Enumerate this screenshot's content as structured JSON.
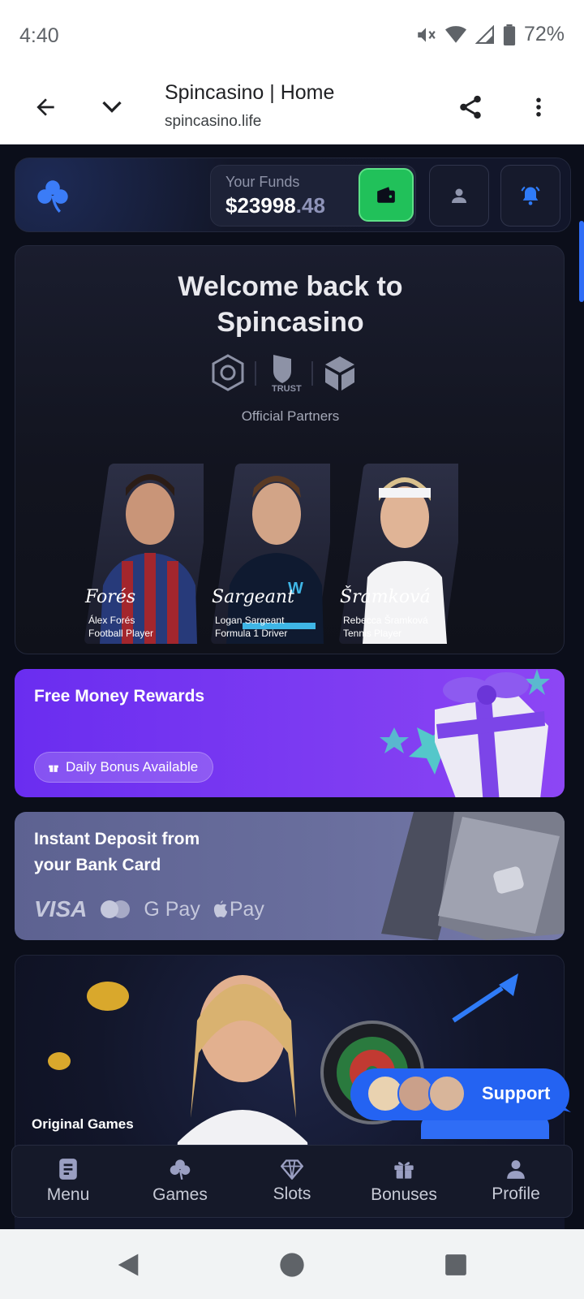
{
  "status_bar": {
    "time": "4:40",
    "battery": "72%",
    "icons": [
      "mute-icon",
      "wifi-icon",
      "signal-icon",
      "battery-icon"
    ]
  },
  "browser": {
    "title": "Spincasino | Home",
    "url": "spincasino.life"
  },
  "header": {
    "funds_label": "Your Funds",
    "funds_whole": "$23998",
    "funds_cents": ".48",
    "accent_green": "#21c15a"
  },
  "welcome": {
    "title": "Welcome back to\nSpincasino",
    "partners_label": "Official Partners",
    "partner_logo_text": "TRUST",
    "players": [
      {
        "signature": "Forés",
        "name": "Álex Forés",
        "role": "Football Player"
      },
      {
        "signature": "Sargeant",
        "name": "Logan Sargeant",
        "role": "Formula 1 Driver"
      },
      {
        "signature": "Šramková",
        "name": "Rebecca Šramková",
        "role": "Tennis Player"
      }
    ]
  },
  "rewards": {
    "title": "Free Money Rewards",
    "badge": "Daily Bonus Available",
    "color": "#7e3cf2"
  },
  "deposit": {
    "title": "Instant Deposit from\nyour Bank Card",
    "methods": [
      "VISA",
      "G Pay",
      "Pay"
    ]
  },
  "games": {
    "label": "Original Games"
  },
  "support": {
    "label": "Support"
  },
  "bottom_nav": {
    "items": [
      {
        "label": "Menu",
        "icon": "menu-icon"
      },
      {
        "label": "Games",
        "icon": "clover-icon"
      },
      {
        "label": "Slots",
        "icon": "gem-icon"
      },
      {
        "label": "Bonuses",
        "icon": "gift-icon"
      },
      {
        "label": "Profile",
        "icon": "profile-icon"
      }
    ]
  }
}
